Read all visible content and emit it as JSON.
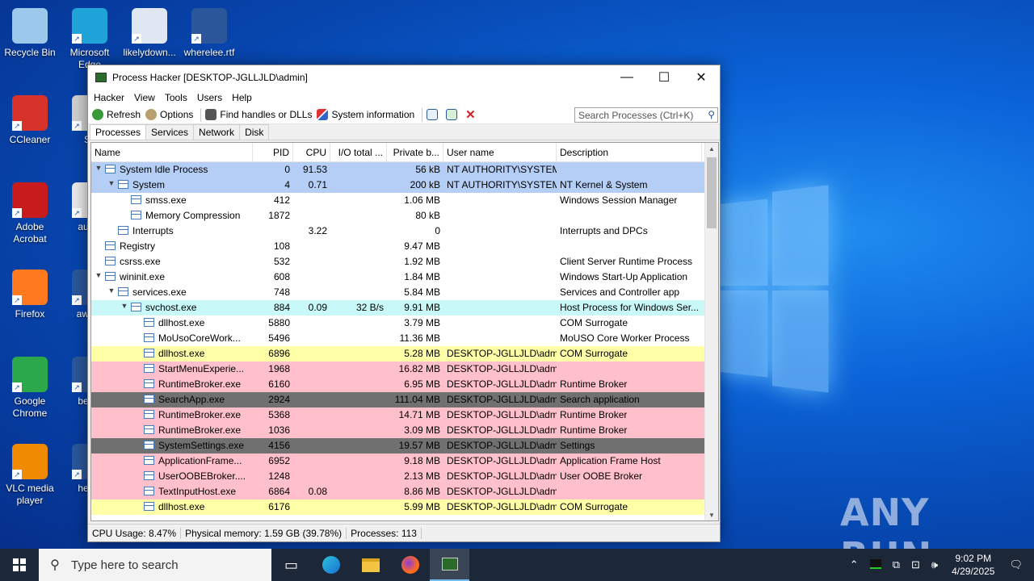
{
  "desktop": {
    "icons": [
      {
        "label": "Recycle Bin",
        "icon": "recycle-bin-icon",
        "color": "#9cc8ec"
      },
      {
        "label": "Microsoft Edge",
        "icon": "edge-icon",
        "color": "#1fa3d8"
      },
      {
        "label": "likelydown...",
        "icon": "image-file-icon",
        "color": "#dfe8f2"
      },
      {
        "label": "wherelee.rtf",
        "icon": "word-document-icon",
        "color": "#2b579a"
      },
      {
        "label": "CCleaner",
        "icon": "ccleaner-icon",
        "color": "#d8322c"
      },
      {
        "label": "Sk",
        "icon": "shortcut-icon",
        "color": "#d0d0d0"
      },
      {
        "label": "Adobe Acrobat",
        "icon": "acrobat-icon",
        "color": "#c81c1c"
      },
      {
        "label": "audio",
        "icon": "audio-file-icon",
        "color": "#e8e8e8"
      },
      {
        "label": "Firefox",
        "icon": "firefox-icon",
        "color": "#ff7a1f"
      },
      {
        "label": "award",
        "icon": "word-document-icon",
        "color": "#2b579a"
      },
      {
        "label": "Google Chrome",
        "icon": "chrome-icon",
        "color": "#2aa84a"
      },
      {
        "label": "bestp",
        "icon": "word-document-icon",
        "color": "#2b579a"
      },
      {
        "label": "VLC media player",
        "icon": "vlc-icon",
        "color": "#f08a00"
      },
      {
        "label": "heldb",
        "icon": "word-document-icon",
        "color": "#2b579a"
      }
    ],
    "watermark": "ANY RUN"
  },
  "window": {
    "title": "Process Hacker [DESKTOP-JGLLJLD\\admin]",
    "minimize": "—",
    "maximize": "☐",
    "close": "✕",
    "menu": [
      "Hacker",
      "View",
      "Tools",
      "Users",
      "Help"
    ],
    "toolbar": {
      "refresh": "Refresh",
      "options": "Options",
      "find": "Find handles or DLLs",
      "sysinfo": "System information"
    },
    "search_placeholder": "Search Processes (Ctrl+K)",
    "tabs": [
      "Processes",
      "Services",
      "Network",
      "Disk"
    ],
    "columns": [
      "Name",
      "PID",
      "CPU",
      "I/O total ...",
      "Private b...",
      "User name",
      "Description"
    ],
    "rows": [
      {
        "name": "System Idle Process",
        "pid": "0",
        "cpu": "91.53",
        "io": "",
        "priv": "56 kB",
        "user": "NT AUTHORITY\\SYSTEM",
        "desc": "",
        "bg": "#b4cef5",
        "fg": "#000000"
      },
      {
        "name": "System",
        "pid": "4",
        "cpu": "0.71",
        "io": "",
        "priv": "200 kB",
        "user": "NT AUTHORITY\\SYSTEM",
        "desc": "NT Kernel & System",
        "bg": "#b4cef5",
        "fg": "#000000"
      },
      {
        "name": "smss.exe",
        "pid": "412",
        "cpu": "",
        "io": "",
        "priv": "1.06 MB",
        "user": "",
        "desc": "Windows Session Manager",
        "bg": "#ffffff",
        "fg": "#000000"
      },
      {
        "name": "Memory Compression",
        "pid": "1872",
        "cpu": "",
        "io": "",
        "priv": "80 kB",
        "user": "",
        "desc": "",
        "bg": "#ffffff",
        "fg": "#000000"
      },
      {
        "name": "Interrupts",
        "pid": "",
        "cpu": "3.22",
        "io": "",
        "priv": "0",
        "user": "",
        "desc": "Interrupts and DPCs",
        "bg": "#ffffff",
        "fg": "#000000"
      },
      {
        "name": "Registry",
        "pid": "108",
        "cpu": "",
        "io": "",
        "priv": "9.47 MB",
        "user": "",
        "desc": "",
        "bg": "#ffffff",
        "fg": "#000000"
      },
      {
        "name": "csrss.exe",
        "pid": "532",
        "cpu": "",
        "io": "",
        "priv": "1.92 MB",
        "user": "",
        "desc": "Client Server Runtime Process",
        "bg": "#ffffff",
        "fg": "#000000"
      },
      {
        "name": "wininit.exe",
        "pid": "608",
        "cpu": "",
        "io": "",
        "priv": "1.84 MB",
        "user": "",
        "desc": "Windows Start-Up Application",
        "bg": "#ffffff",
        "fg": "#000000"
      },
      {
        "name": "services.exe",
        "pid": "748",
        "cpu": "",
        "io": "",
        "priv": "5.84 MB",
        "user": "",
        "desc": "Services and Controller app",
        "bg": "#ffffff",
        "fg": "#000000"
      },
      {
        "name": "svchost.exe",
        "pid": "884",
        "cpu": "0.09",
        "io": "32 B/s",
        "priv": "9.91 MB",
        "user": "",
        "desc": "Host Process for Windows Ser...",
        "bg": "#c8f8f8",
        "fg": "#000000"
      },
      {
        "name": "dllhost.exe",
        "pid": "5880",
        "cpu": "",
        "io": "",
        "priv": "3.79 MB",
        "user": "",
        "desc": "COM Surrogate",
        "bg": "#ffffff",
        "fg": "#000000"
      },
      {
        "name": "MoUsoCoreWork...",
        "pid": "5496",
        "cpu": "",
        "io": "",
        "priv": "11.36 MB",
        "user": "",
        "desc": "MoUSO Core Worker Process",
        "bg": "#ffffff",
        "fg": "#000000"
      },
      {
        "name": "dllhost.exe",
        "pid": "6896",
        "cpu": "",
        "io": "",
        "priv": "5.28 MB",
        "user": "DESKTOP-JGLLJLD\\admi",
        "desc": "COM Surrogate",
        "bg": "#ffffa8",
        "fg": "#000000"
      },
      {
        "name": "StartMenuExperie...",
        "pid": "1968",
        "cpu": "",
        "io": "",
        "priv": "16.82 MB",
        "user": "DESKTOP-JGLLJLD\\admi",
        "desc": "",
        "bg": "#ffc0cb",
        "fg": "#000000"
      },
      {
        "name": "RuntimeBroker.exe",
        "pid": "6160",
        "cpu": "",
        "io": "",
        "priv": "6.95 MB",
        "user": "DESKTOP-JGLLJLD\\admi",
        "desc": "Runtime Broker",
        "bg": "#ffc0cb",
        "fg": "#000000"
      },
      {
        "name": "SearchApp.exe",
        "pid": "2924",
        "cpu": "",
        "io": "",
        "priv": "111.04 MB",
        "user": "DESKTOP-JGLLJLD\\admi",
        "desc": "Search application",
        "bg": "#707070",
        "fg": "#000000"
      },
      {
        "name": "RuntimeBroker.exe",
        "pid": "5368",
        "cpu": "",
        "io": "",
        "priv": "14.71 MB",
        "user": "DESKTOP-JGLLJLD\\admi",
        "desc": "Runtime Broker",
        "bg": "#ffc0cb",
        "fg": "#000000"
      },
      {
        "name": "RuntimeBroker.exe",
        "pid": "1036",
        "cpu": "",
        "io": "",
        "priv": "3.09 MB",
        "user": "DESKTOP-JGLLJLD\\admi",
        "desc": "Runtime Broker",
        "bg": "#ffc0cb",
        "fg": "#000000"
      },
      {
        "name": "SystemSettings.exe",
        "pid": "4156",
        "cpu": "",
        "io": "",
        "priv": "19.57 MB",
        "user": "DESKTOP-JGLLJLD\\admi",
        "desc": "Settings",
        "bg": "#707070",
        "fg": "#000000"
      },
      {
        "name": "ApplicationFrame...",
        "pid": "6952",
        "cpu": "",
        "io": "",
        "priv": "9.18 MB",
        "user": "DESKTOP-JGLLJLD\\admi",
        "desc": "Application Frame Host",
        "bg": "#ffc0cb",
        "fg": "#000000"
      },
      {
        "name": "UserOOBEBroker....",
        "pid": "1248",
        "cpu": "",
        "io": "",
        "priv": "2.13 MB",
        "user": "DESKTOP-JGLLJLD\\admi",
        "desc": "User OOBE Broker",
        "bg": "#ffc0cb",
        "fg": "#000000"
      },
      {
        "name": "TextInputHost.exe",
        "pid": "6864",
        "cpu": "0.08",
        "io": "",
        "priv": "8.86 MB",
        "user": "DESKTOP-JGLLJLD\\admi",
        "desc": "",
        "bg": "#ffc0cb",
        "fg": "#000000"
      },
      {
        "name": "dllhost.exe",
        "pid": "6176",
        "cpu": "",
        "io": "",
        "priv": "5.99 MB",
        "user": "DESKTOP-JGLLJLD\\admi",
        "desc": "COM Surrogate",
        "bg": "#ffffa8",
        "fg": "#000000"
      }
    ],
    "status": {
      "cpu": "CPU Usage: 8.47%",
      "mem": "Physical memory: 1.59 GB (39.78%)",
      "procs": "Processes: 113"
    }
  },
  "taskbar": {
    "search_placeholder": "Type here to search",
    "time": "9:02 PM",
    "date": "4/29/2025"
  }
}
